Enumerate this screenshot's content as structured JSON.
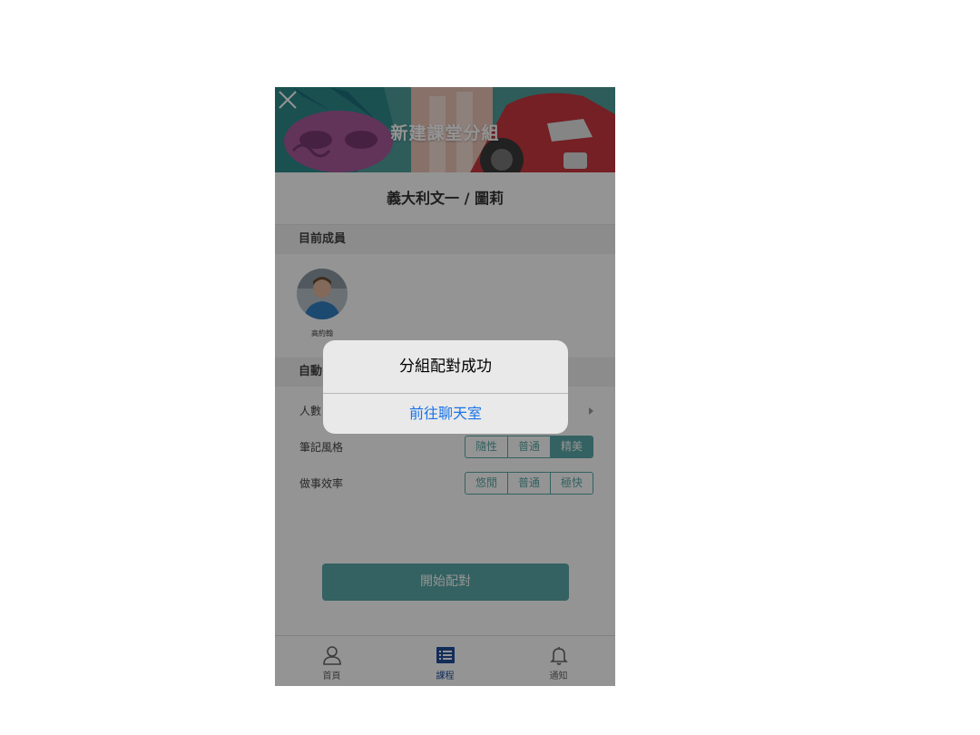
{
  "header": {
    "title": "新建課堂分組",
    "close_icon": "close-icon"
  },
  "class_name": "義大利文一 / 圖莉",
  "members_section": {
    "title": "目前成員",
    "members": [
      {
        "name": "高約翰"
      }
    ]
  },
  "auto_section": {
    "title": "自動",
    "rows": {
      "people": {
        "label": "人數"
      },
      "notes": {
        "label": "筆記風格",
        "options": [
          "隨性",
          "普通",
          "精美"
        ],
        "selected": "精美"
      },
      "efficiency": {
        "label": "做事效率",
        "options": [
          "悠閒",
          "普通",
          "極快"
        ],
        "selected": null
      }
    }
  },
  "start_button": "開始配對",
  "tabbar": {
    "tabs": [
      {
        "label": "首頁",
        "icon": "user-icon",
        "active": false
      },
      {
        "label": "課程",
        "icon": "list-icon",
        "active": true
      },
      {
        "label": "通知",
        "icon": "bell-icon",
        "active": false
      }
    ]
  },
  "dialog": {
    "title": "分組配對成功",
    "action": "前往聊天室"
  },
  "colors": {
    "accent": "#5aa8a8",
    "link": "#1a73e8",
    "active_tab": "#1f4e9c"
  }
}
